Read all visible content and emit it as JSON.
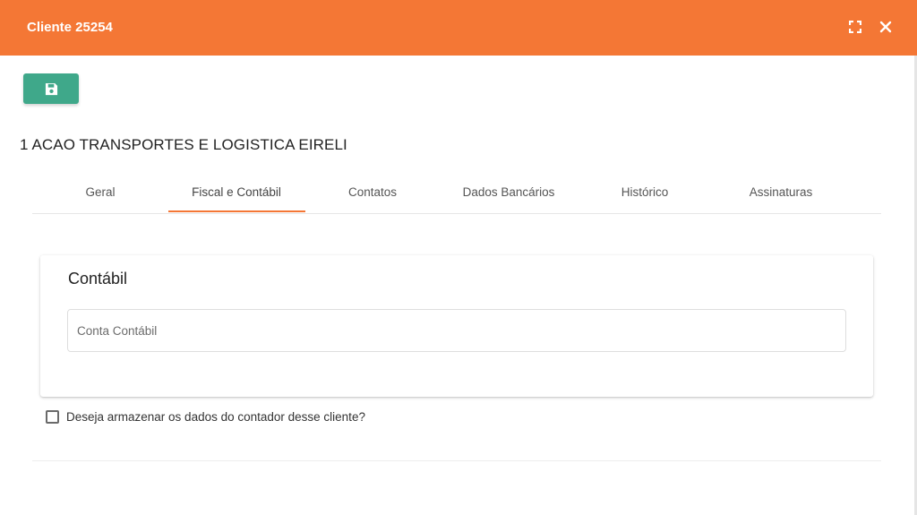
{
  "header": {
    "title": "Cliente 25254",
    "expand_icon": "expand-icon",
    "close_icon": "close-icon",
    "background_color": "#f47735"
  },
  "toolbar": {
    "save_icon": "floppy-disk-icon",
    "save_color": "#3fa88a"
  },
  "company": {
    "name": "1 ACAO TRANSPORTES E LOGISTICA EIRELI"
  },
  "tabs": [
    {
      "label": "Geral",
      "active": false
    },
    {
      "label": "Fiscal e Contábil",
      "active": true
    },
    {
      "label": "Contatos",
      "active": false
    },
    {
      "label": "Dados Bancários",
      "active": false
    },
    {
      "label": "Histórico",
      "active": false
    },
    {
      "label": "Assinaturas",
      "active": false
    }
  ],
  "contabil": {
    "title": "Contábil",
    "conta_contabil": {
      "placeholder": "Conta Contábil",
      "value": ""
    }
  },
  "contador": {
    "checkbox_label": "Deseja armazenar os dados do contador desse cliente?",
    "checked": false
  }
}
